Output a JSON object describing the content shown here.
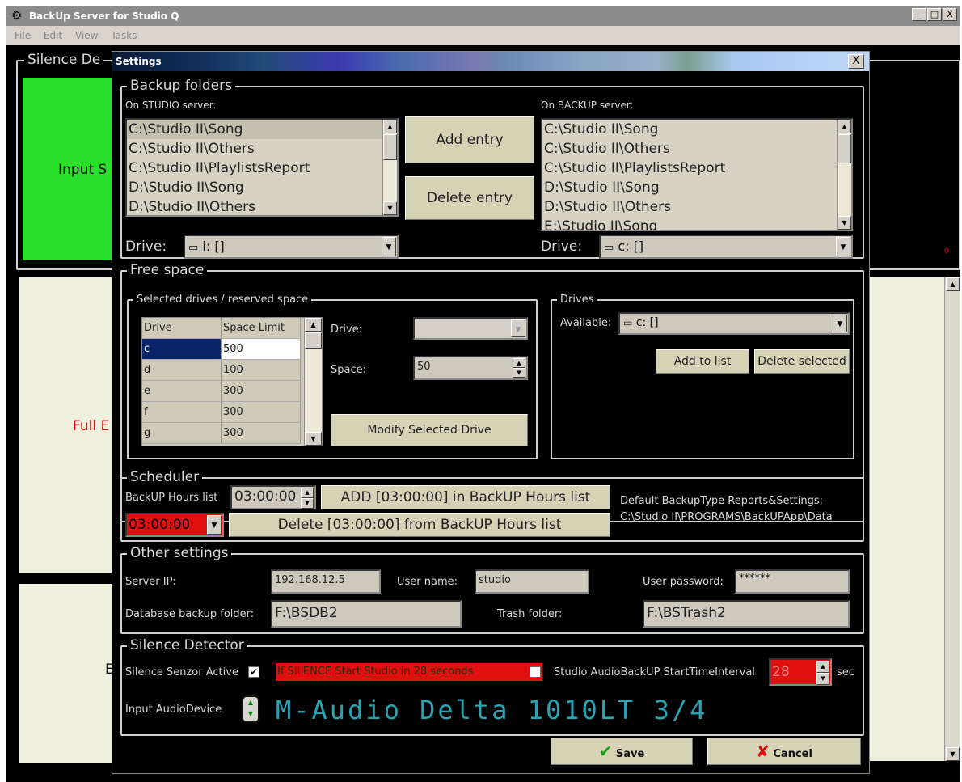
{
  "main_window": {
    "title": "BackUp Server for Studio Q",
    "menu": [
      "File",
      "Edit",
      "View",
      "Tasks"
    ],
    "win_buttons": [
      "_",
      "□",
      "X"
    ],
    "bg_silence_title": "Silence De",
    "bg_input_label": "Input S",
    "bg_full_label": "Full E",
    "bg_e_label": "E",
    "bg_small_red": "0"
  },
  "settings": {
    "title": "Settings",
    "close": "X",
    "backup_folders": {
      "title": "Backup folders",
      "studio_label": "On STUDIO server:",
      "backup_label": "On BACKUP server:",
      "studio_items": [
        "C:\\Studio II\\Song",
        "C:\\Studio II\\Others",
        "C:\\Studio II\\PlaylistsReport",
        "D:\\Studio II\\Song",
        "D:\\Studio II\\Others"
      ],
      "backup_items": [
        "C:\\Studio II\\Song",
        "C:\\Studio II\\Others",
        "C:\\Studio II\\PlaylistsReport",
        "D:\\Studio II\\Song",
        "D:\\Studio II\\Others",
        "E:\\Studio II\\Song"
      ],
      "add_entry": "Add entry",
      "delete_entry": "Delete entry",
      "drive_label": "Drive:",
      "studio_drive": "i: []",
      "backup_drive": "c: []"
    },
    "free_space": {
      "title": "Free space",
      "selected_title": "Selected drives / reserved space",
      "col_drive": "Drive",
      "col_limit": "Space Limit",
      "rows": [
        {
          "drive": "c",
          "limit": "500"
        },
        {
          "drive": "d",
          "limit": "100"
        },
        {
          "drive": "e",
          "limit": "300"
        },
        {
          "drive": "f",
          "limit": "300"
        },
        {
          "drive": "g",
          "limit": "300"
        }
      ],
      "drive_label": "Drive:",
      "space_label": "Space:",
      "space_value": "50",
      "modify_button": "Modify Selected Drive",
      "drives_title": "Drives",
      "available_label": "Available:",
      "available_value": "c: []",
      "add_to_list": "Add to list",
      "delete_selected": "Delete selected"
    },
    "scheduler": {
      "title": "Scheduler",
      "hours_list_label": "BackUP Hours list",
      "time_value": "03:00:00",
      "selected_hour": "03:00:00",
      "add_button": "ADD [03:00:00] in BackUP Hours list",
      "delete_button": "Delete [03:00:00] from BackUP Hours list",
      "default_label": "Default BackupType Reports&Settings:",
      "default_path": "C:\\Studio II\\PROGRAMS\\BackUPApp\\Data"
    },
    "other": {
      "title": "Other settings",
      "server_ip_label": "Server IP:",
      "server_ip": "192.168.12.5",
      "user_name_label": "User name:",
      "user_name": "studio",
      "password_label": "User password:",
      "password": "******",
      "db_folder_label": "Database backup folder:",
      "db_folder": "F:\\BSDB2",
      "trash_label": "Trash folder:",
      "trash": "F:\\BSTrash2"
    },
    "silence": {
      "title": "Silence Detector",
      "senzor_label": "Silence Senzor Active",
      "if_silence": "If SILENCE Start Studio in 28 seconds",
      "interval_label": "Studio AudioBackUP StartTimeInterval",
      "interval_value": "28",
      "sec": "sec",
      "input_device_label": "Input AudioDevice",
      "device_name": "M-Audio Delta 1010LT 3/4"
    },
    "save": "Save",
    "cancel": "Cancel"
  },
  "colors": {
    "accent_green": "#2be02b",
    "alert_red": "#e01010",
    "lcd": "#2aa4b4"
  }
}
